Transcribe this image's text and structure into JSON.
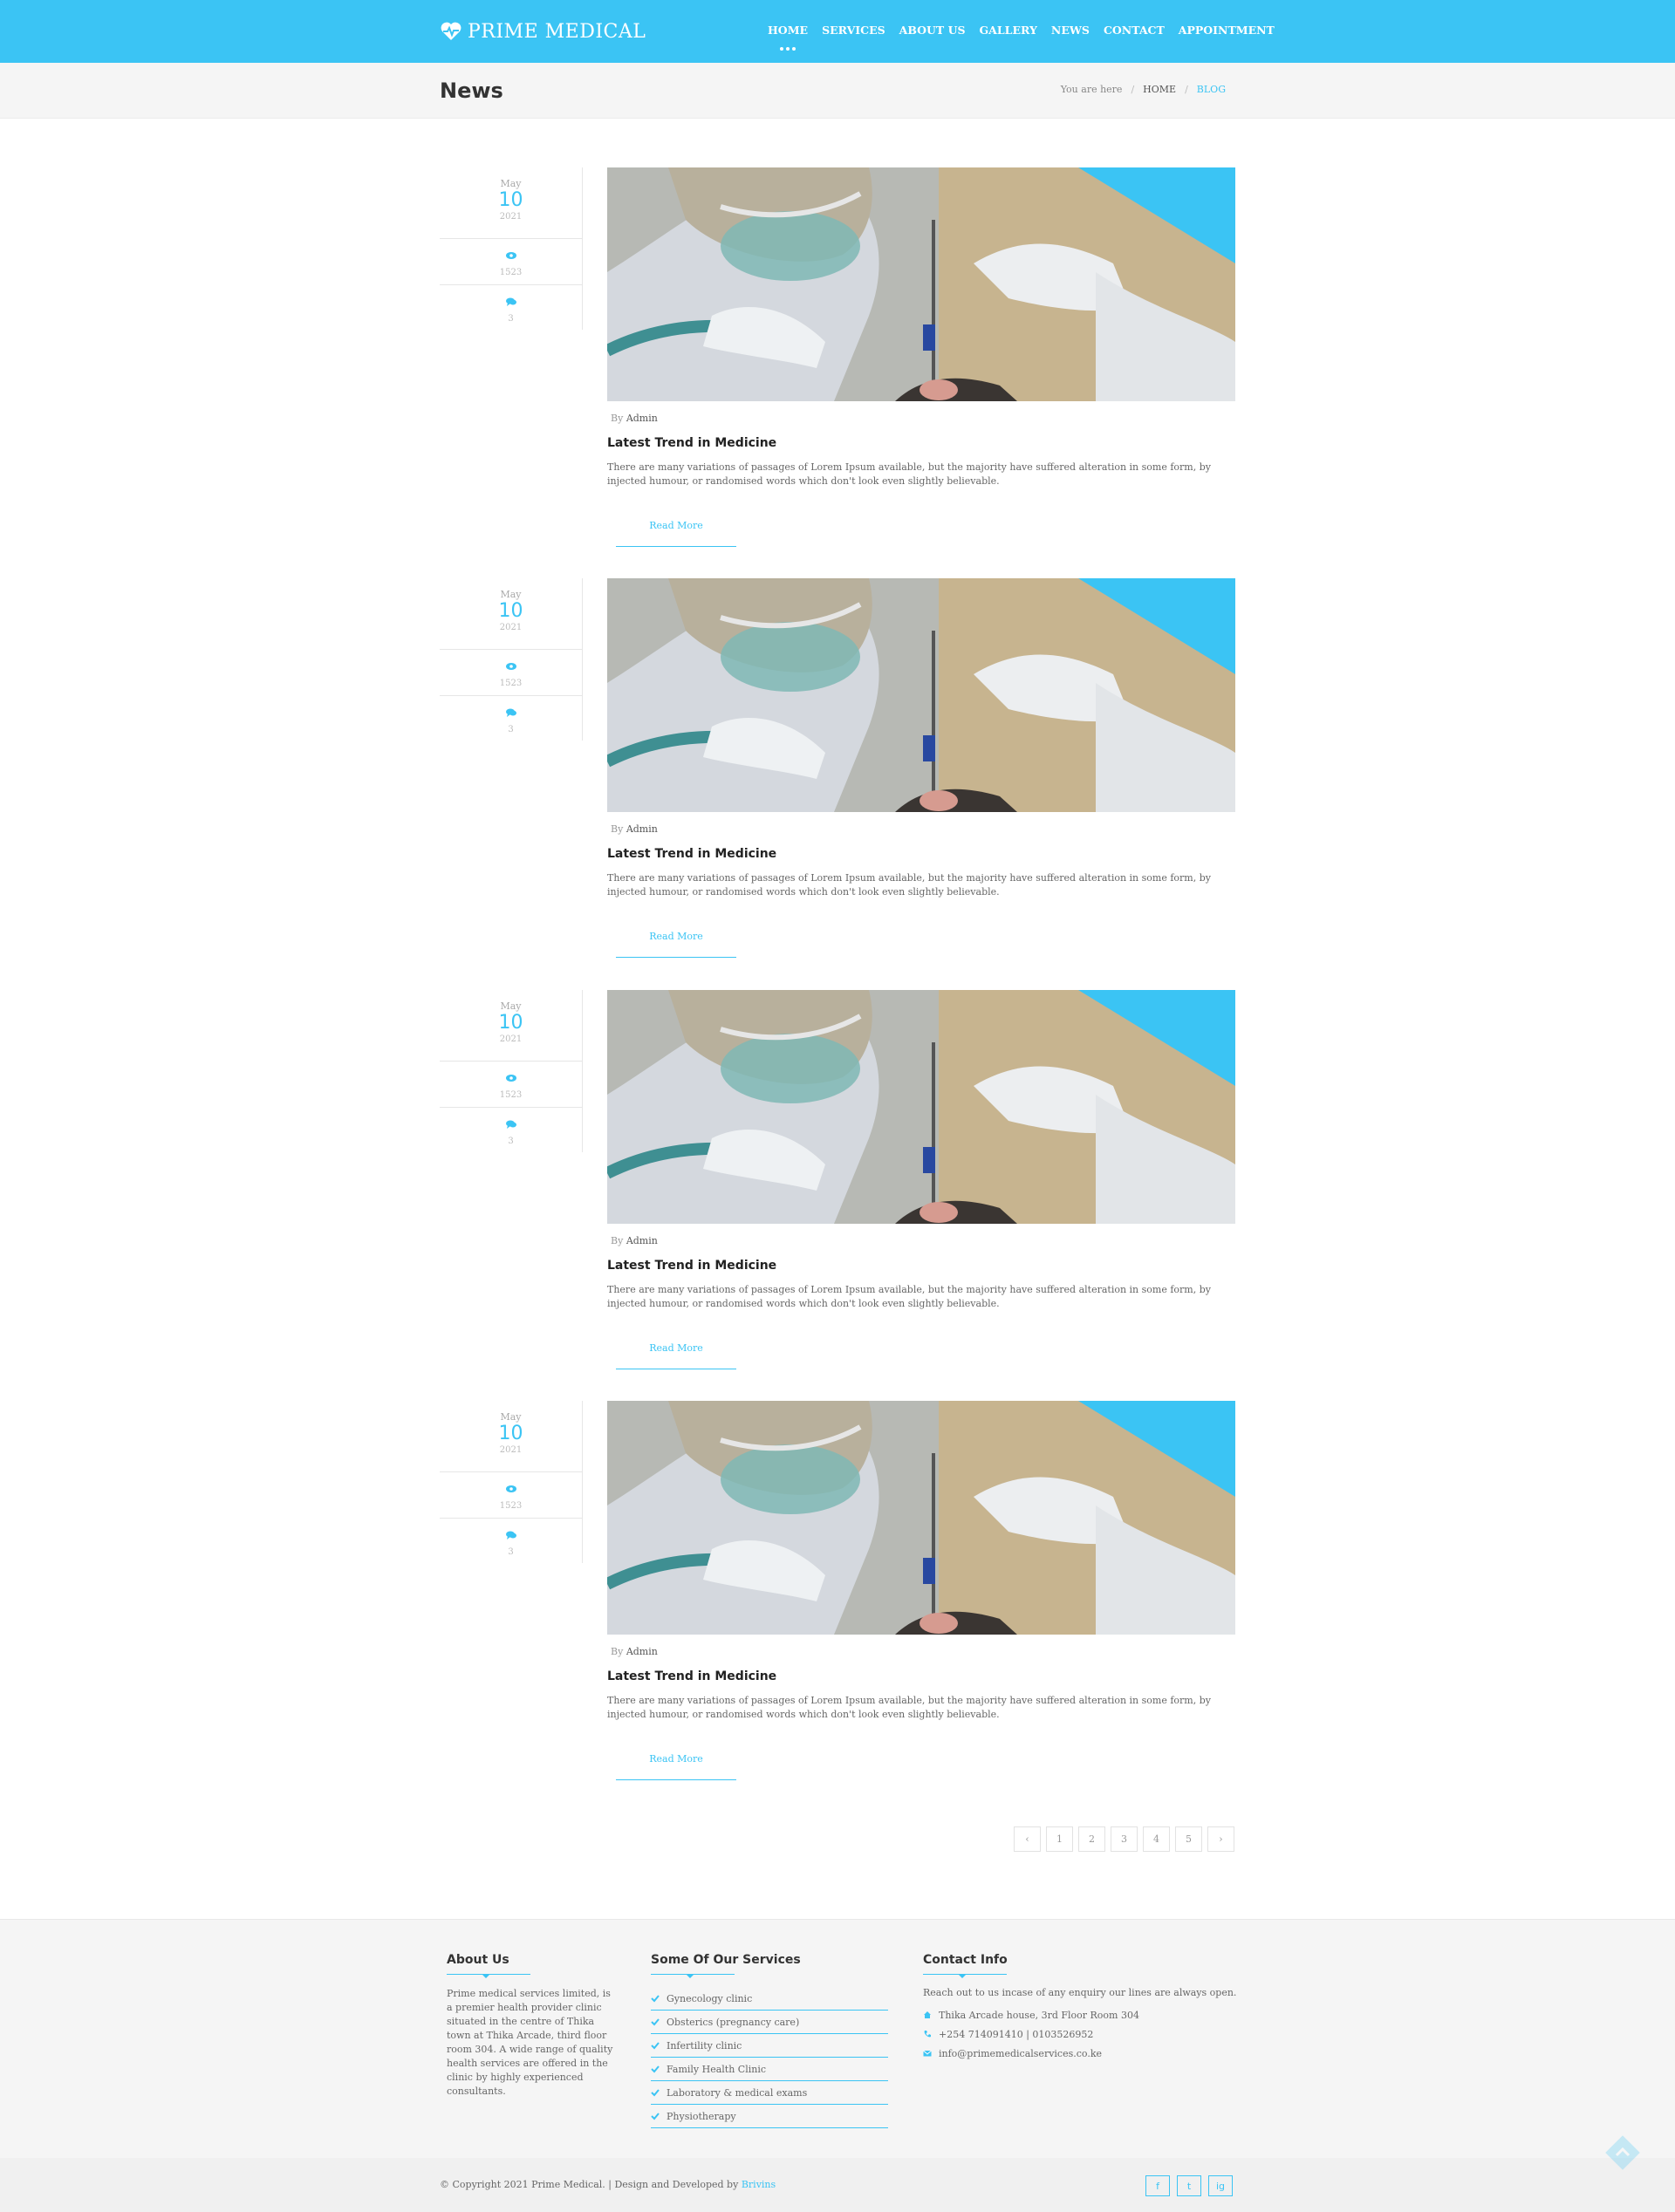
{
  "header": {
    "logo_text": "PRIME MEDICAL",
    "nav": [
      "HOME",
      "SERVICES",
      "ABOUT US",
      "GALLERY",
      "NEWS",
      "CONTACT",
      "APPOINTMENT"
    ],
    "active_nav": "HOME"
  },
  "titlebar": {
    "title": "News",
    "breadcrumb_label": "You are here",
    "breadcrumb_home": "HOME",
    "breadcrumb_current": "BLOG"
  },
  "posts": [
    {
      "month": "May",
      "day": "10",
      "year": "2021",
      "views": "1523",
      "comments": "3",
      "by_label": "By",
      "author": "Admin",
      "title": "Latest Trend in Medicine",
      "excerpt": "There are many variations of passages of Lorem Ipsum available, but the majority have suffered alteration in some form, by injected humour, or randomised words which don't look even slightly believable.",
      "read_more": "Read More"
    },
    {
      "month": "May",
      "day": "10",
      "year": "2021",
      "views": "1523",
      "comments": "3",
      "by_label": "By",
      "author": "Admin",
      "title": "Latest Trend in Medicine",
      "excerpt": "There are many variations of passages of Lorem Ipsum available, but the majority have suffered alteration in some form, by injected humour, or randomised words which don't look even slightly believable.",
      "read_more": "Read More"
    },
    {
      "month": "May",
      "day": "10",
      "year": "2021",
      "views": "1523",
      "comments": "3",
      "by_label": "By",
      "author": "Admin",
      "title": "Latest Trend in Medicine",
      "excerpt": "There are many variations of passages of Lorem Ipsum available, but the majority have suffered alteration in some form, by injected humour, or randomised words which don't look even slightly believable.",
      "read_more": "Read More"
    },
    {
      "month": "May",
      "day": "10",
      "year": "2021",
      "views": "1523",
      "comments": "3",
      "by_label": "By",
      "author": "Admin",
      "title": "Latest Trend in Medicine",
      "excerpt": "There are many variations of passages of Lorem Ipsum available, but the majority have suffered alteration in some form, by injected humour, or randomised words which don't look even slightly believable.",
      "read_more": "Read More"
    }
  ],
  "pagination": {
    "prev": "‹",
    "pages": [
      "1",
      "2",
      "3",
      "4",
      "5"
    ],
    "next": "›"
  },
  "footer": {
    "about": {
      "heading": "About Us",
      "text": "Prime medical services limited, is a premier health provider clinic situated in the centre of Thika town at Thika Arcade, third floor room 304. A wide range of quality health services are offered in the clinic by highly experienced consultants."
    },
    "services": {
      "heading": "Some Of Our Services",
      "items": [
        "Gynecology clinic",
        "Obsterics (pregnancy care)",
        "Infertility clinic",
        "Family Health Clinic",
        "Laboratory & medical exams",
        "Physiotherapy"
      ]
    },
    "contact": {
      "heading": "Contact Info",
      "intro": "Reach out to us incase of any enquiry our lines are always open.",
      "address": "Thika Arcade house, 3rd Floor Room 304",
      "phone": "+254 714091410 | 0103526952",
      "email": "info@primemedicalservices.co.ke"
    },
    "copyright_text": "© Copyright 2021 Prime Medical. | Design and Developed by",
    "developer": "Brivins",
    "socials": [
      "f",
      "t",
      "ig"
    ]
  },
  "colors": {
    "accent": "#3bc4f4",
    "titlebar_bg": "#f5f5f5",
    "footer_bg": "#f5f5f5"
  },
  "icons": {
    "views": "eye-icon",
    "comments": "comment-icon",
    "logo": "heart-pulse-icon"
  }
}
